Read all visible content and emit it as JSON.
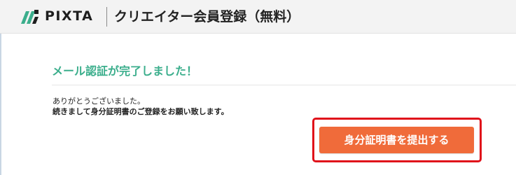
{
  "header": {
    "logo_text": "PIXTA",
    "logo_icon": "pixta-logo-icon",
    "title": "クリエイター会員登録（無料）"
  },
  "main": {
    "heading": "メール認証が完了しました！",
    "message_line1": "ありがとうございました。",
    "message_line2": "続きまして身分証明書のご登録をお願い致します。",
    "submit_button_label": "身分証明書を提出する"
  },
  "colors": {
    "header_bg": "#f3f3f3",
    "heading_green": "#3bae8c",
    "button_orange": "#f06b3a",
    "highlight_red": "#e0101a"
  }
}
